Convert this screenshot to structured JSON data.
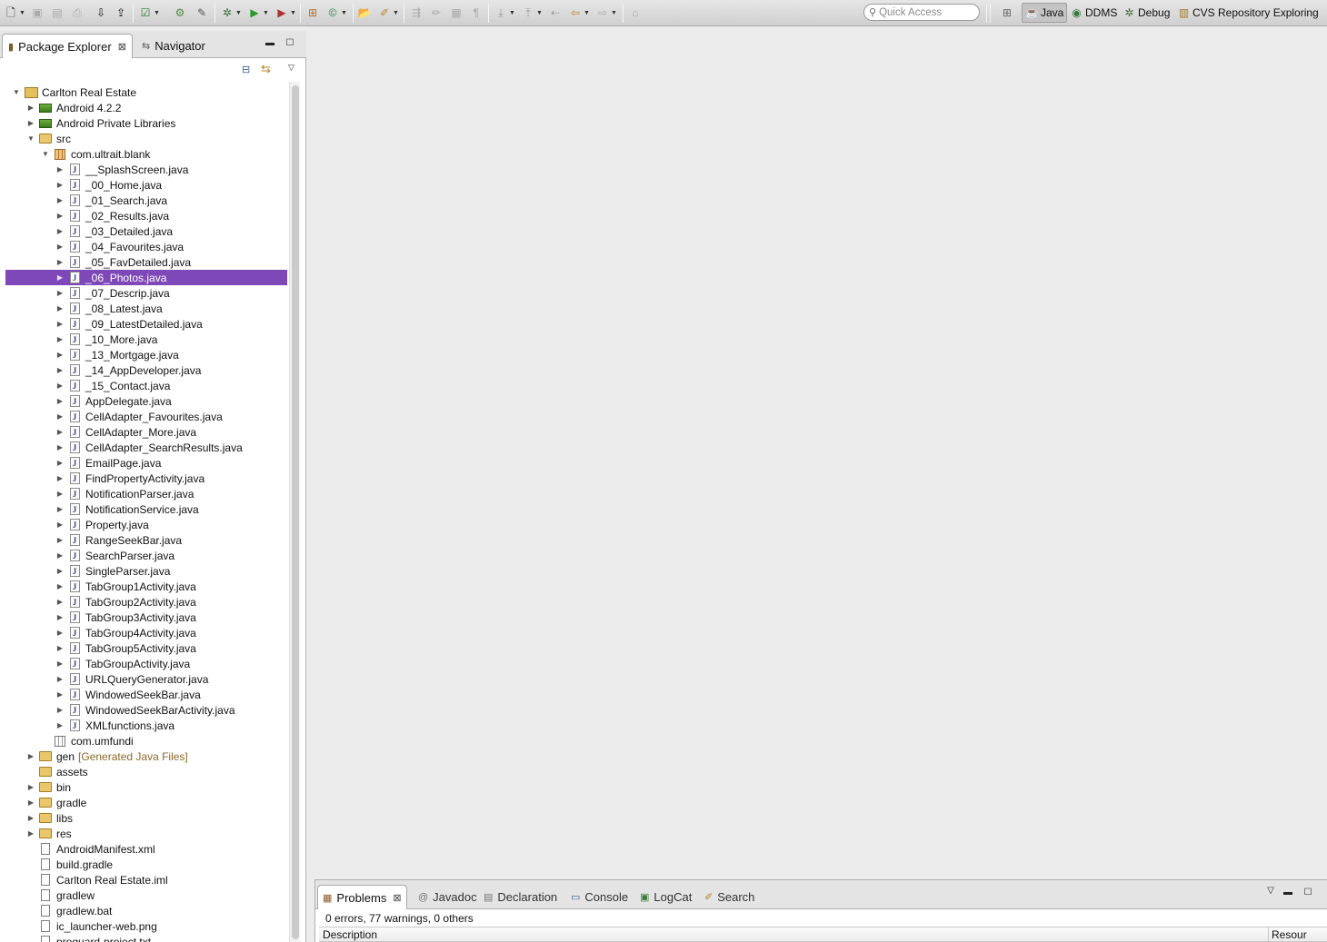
{
  "toolbar": {
    "quick_access_placeholder": "Quick Access",
    "perspectives": [
      {
        "label": "Java",
        "icon": "java-perspective-icon",
        "active": true
      },
      {
        "label": "DDMS",
        "icon": "ddms-icon",
        "active": false
      },
      {
        "label": "Debug",
        "icon": "debug-bug-icon",
        "active": false
      },
      {
        "label": "CVS Repository Exploring",
        "icon": "cvs-icon",
        "active": false
      }
    ]
  },
  "left_view": {
    "tabs": [
      {
        "label": "Package Explorer",
        "active": true
      },
      {
        "label": "Navigator",
        "active": false
      }
    ]
  },
  "tree": [
    {
      "label": "Carlton Real Estate",
      "kind": "project",
      "depth": 0,
      "toggle": "open"
    },
    {
      "label": "Android 4.2.2",
      "kind": "lib",
      "depth": 1,
      "toggle": "closed"
    },
    {
      "label": "Android Private Libraries",
      "kind": "lib",
      "depth": 1,
      "toggle": "closed"
    },
    {
      "label": "src",
      "kind": "srcfolder",
      "depth": 1,
      "toggle": "open"
    },
    {
      "label": "com.ultrait.blank",
      "kind": "package",
      "depth": 2,
      "toggle": "open"
    },
    {
      "label": "__SplashScreen.java",
      "kind": "java",
      "depth": 3,
      "toggle": "closed"
    },
    {
      "label": "_00_Home.java",
      "kind": "java",
      "depth": 3,
      "toggle": "closed"
    },
    {
      "label": "_01_Search.java",
      "kind": "java",
      "depth": 3,
      "toggle": "closed"
    },
    {
      "label": "_02_Results.java",
      "kind": "java",
      "depth": 3,
      "toggle": "closed"
    },
    {
      "label": "_03_Detailed.java",
      "kind": "java",
      "depth": 3,
      "toggle": "closed"
    },
    {
      "label": "_04_Favourites.java",
      "kind": "java",
      "depth": 3,
      "toggle": "closed"
    },
    {
      "label": "_05_FavDetailed.java",
      "kind": "java",
      "depth": 3,
      "toggle": "closed"
    },
    {
      "label": "_06_Photos.java",
      "kind": "java",
      "depth": 3,
      "toggle": "closed",
      "selected": true
    },
    {
      "label": "_07_Descrip.java",
      "kind": "java",
      "depth": 3,
      "toggle": "closed"
    },
    {
      "label": "_08_Latest.java",
      "kind": "java",
      "depth": 3,
      "toggle": "closed"
    },
    {
      "label": "_09_LatestDetailed.java",
      "kind": "java",
      "depth": 3,
      "toggle": "closed"
    },
    {
      "label": "_10_More.java",
      "kind": "java",
      "depth": 3,
      "toggle": "closed"
    },
    {
      "label": "_13_Mortgage.java",
      "kind": "java",
      "depth": 3,
      "toggle": "closed"
    },
    {
      "label": "_14_AppDeveloper.java",
      "kind": "java",
      "depth": 3,
      "toggle": "closed"
    },
    {
      "label": "_15_Contact.java",
      "kind": "java",
      "depth": 3,
      "toggle": "closed"
    },
    {
      "label": "AppDelegate.java",
      "kind": "java",
      "depth": 3,
      "toggle": "closed"
    },
    {
      "label": "CellAdapter_Favourites.java",
      "kind": "java",
      "depth": 3,
      "toggle": "closed"
    },
    {
      "label": "CellAdapter_More.java",
      "kind": "java",
      "depth": 3,
      "toggle": "closed"
    },
    {
      "label": "CellAdapter_SearchResults.java",
      "kind": "java",
      "depth": 3,
      "toggle": "closed"
    },
    {
      "label": "EmailPage.java",
      "kind": "java",
      "depth": 3,
      "toggle": "closed"
    },
    {
      "label": "FindPropertyActivity.java",
      "kind": "java",
      "depth": 3,
      "toggle": "closed"
    },
    {
      "label": "NotificationParser.java",
      "kind": "java",
      "depth": 3,
      "toggle": "closed"
    },
    {
      "label": "NotificationService.java",
      "kind": "java",
      "depth": 3,
      "toggle": "closed"
    },
    {
      "label": "Property.java",
      "kind": "java",
      "depth": 3,
      "toggle": "closed"
    },
    {
      "label": "RangeSeekBar.java",
      "kind": "java",
      "depth": 3,
      "toggle": "closed"
    },
    {
      "label": "SearchParser.java",
      "kind": "java",
      "depth": 3,
      "toggle": "closed"
    },
    {
      "label": "SingleParser.java",
      "kind": "java",
      "depth": 3,
      "toggle": "closed"
    },
    {
      "label": "TabGroup1Activity.java",
      "kind": "java",
      "depth": 3,
      "toggle": "closed"
    },
    {
      "label": "TabGroup2Activity.java",
      "kind": "java",
      "depth": 3,
      "toggle": "closed"
    },
    {
      "label": "TabGroup3Activity.java",
      "kind": "java",
      "depth": 3,
      "toggle": "closed"
    },
    {
      "label": "TabGroup4Activity.java",
      "kind": "java",
      "depth": 3,
      "toggle": "closed"
    },
    {
      "label": "TabGroup5Activity.java",
      "kind": "java",
      "depth": 3,
      "toggle": "closed"
    },
    {
      "label": "TabGroupActivity.java",
      "kind": "java",
      "depth": 3,
      "toggle": "closed"
    },
    {
      "label": "URLQueryGenerator.java",
      "kind": "java",
      "depth": 3,
      "toggle": "closed"
    },
    {
      "label": "WindowedSeekBar.java",
      "kind": "java",
      "depth": 3,
      "toggle": "closed"
    },
    {
      "label": "WindowedSeekBarActivity.java",
      "kind": "java",
      "depth": 3,
      "toggle": "closed"
    },
    {
      "label": "XMLfunctions.java",
      "kind": "java",
      "depth": 3,
      "toggle": "closed"
    },
    {
      "label": "com.umfundi",
      "kind": "package-empty",
      "depth": 2,
      "toggle": "none"
    },
    {
      "label": "gen",
      "suffix": "[Generated Java Files]",
      "kind": "srcfolder",
      "depth": 1,
      "toggle": "closed"
    },
    {
      "label": "assets",
      "kind": "folder",
      "depth": 1,
      "toggle": "none"
    },
    {
      "label": "bin",
      "kind": "folder",
      "depth": 1,
      "toggle": "closed"
    },
    {
      "label": "gradle",
      "kind": "folder",
      "depth": 1,
      "toggle": "closed"
    },
    {
      "label": "libs",
      "kind": "folder",
      "depth": 1,
      "toggle": "closed"
    },
    {
      "label": "res",
      "kind": "folder",
      "depth": 1,
      "toggle": "closed"
    },
    {
      "label": "AndroidManifest.xml",
      "kind": "file",
      "depth": 1,
      "toggle": "none"
    },
    {
      "label": "build.gradle",
      "kind": "file",
      "depth": 1,
      "toggle": "none"
    },
    {
      "label": "Carlton Real Estate.iml",
      "kind": "file",
      "depth": 1,
      "toggle": "none"
    },
    {
      "label": "gradlew",
      "kind": "file",
      "depth": 1,
      "toggle": "none"
    },
    {
      "label": "gradlew.bat",
      "kind": "file",
      "depth": 1,
      "toggle": "none"
    },
    {
      "label": "ic_launcher-web.png",
      "kind": "image",
      "depth": 1,
      "toggle": "none"
    },
    {
      "label": "proguard-project.txt",
      "kind": "file",
      "depth": 1,
      "toggle": "none"
    }
  ],
  "bottom_view": {
    "tabs": [
      {
        "label": "Problems",
        "icon": "problems-icon",
        "active": true
      },
      {
        "label": "Javadoc",
        "icon": "javadoc-at-icon",
        "active": false
      },
      {
        "label": "Declaration",
        "icon": "declaration-icon",
        "active": false
      },
      {
        "label": "Console",
        "icon": "console-icon",
        "active": false
      },
      {
        "label": "LogCat",
        "icon": "logcat-icon",
        "active": false
      },
      {
        "label": "Search",
        "icon": "search-flashlight-icon",
        "active": false
      }
    ],
    "summary": "0 errors, 77 warnings, 0 others",
    "columns": {
      "description": "Description",
      "resource": "Resour"
    }
  },
  "colors": {
    "selection": "#7e48b8",
    "background": "#ececec"
  }
}
